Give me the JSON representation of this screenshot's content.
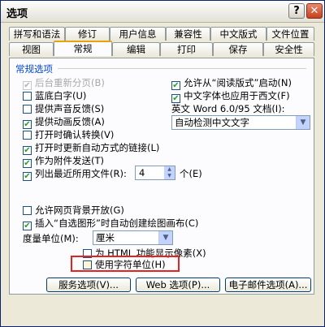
{
  "window": {
    "title": "选项"
  },
  "titlebar_buttons": {
    "help": "?",
    "close": "✕"
  },
  "tabs_back": [
    "拼写和语法",
    "修订",
    "用户信息",
    "兼容性",
    "中文版式",
    "文件位置"
  ],
  "tabs_front": [
    "视图",
    "常规",
    "编辑",
    "打印",
    "保存",
    "安全性"
  ],
  "section": {
    "title": "常规选项"
  },
  "left_options": [
    {
      "label": "后台重新分页(B)",
      "checked": true,
      "disabled": true
    },
    {
      "label": "蓝底白字(U)",
      "checked": false
    },
    {
      "label": "提供声音反馈(S)",
      "checked": false
    },
    {
      "label": "提供动画反馈(A)",
      "checked": true
    },
    {
      "label": "打开时确认转换(V)",
      "checked": false
    },
    {
      "label": "打开时更新自动方式的链接(L)",
      "checked": true
    },
    {
      "label": "作为附件发送(T)",
      "checked": true
    },
    {
      "label": "列出最近所用文件(R):",
      "checked": true
    }
  ],
  "right_options": [
    {
      "label": "允许从“阅读版式”启动(N)",
      "checked": true
    },
    {
      "label": "中文字体也应用于西文(F)",
      "checked": true
    }
  ],
  "doc_label": "英文 Word 6.0/95 文档(I):",
  "doc_select": "自动检测中文文字",
  "recent_count": "4",
  "recent_unit": "个(E)",
  "lower_options": [
    {
      "label": "允许网页背景开放(G)",
      "checked": false
    },
    {
      "label": "插入“自选图形”时自动创建绘图画布(C)",
      "checked": true
    }
  ],
  "measure_label": "度量单位(M):",
  "measure_select": "厘米",
  "html_option": {
    "label": "为 HTML 功能显示像素(X)",
    "checked": false
  },
  "char_unit_option": {
    "label": "使用字符单位(H)",
    "checked": false
  },
  "buttons": {
    "service": "服务选项(V)...",
    "web": "Web 选项(P)...",
    "email": "电子邮件选项(A)..."
  },
  "icons": {
    "check": "✔",
    "dropdown": "▼",
    "spin_up": "▲",
    "spin_down": "▼"
  }
}
